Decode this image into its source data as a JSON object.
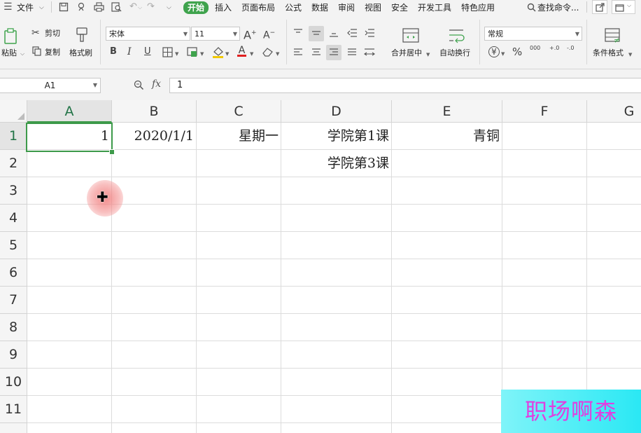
{
  "menubar": {
    "file_label": "文件",
    "tabs": [
      "开始",
      "插入",
      "页面布局",
      "公式",
      "数据",
      "审阅",
      "视图",
      "安全",
      "开发工具",
      "特色应用"
    ],
    "active_tab": "开始",
    "search_label": "查找命令...",
    "accent_color": "#3fa34d"
  },
  "ribbon": {
    "paste_label": "粘贴",
    "cut_label": "剪切",
    "copy_label": "复制",
    "format_painter_label": "格式刷",
    "font_name": "宋体",
    "font_size": "11",
    "grow_font_label": "A",
    "shrink_font_label": "A",
    "bold_label": "B",
    "italic_label": "I",
    "underline_label": "U",
    "font_color_label": "A",
    "merge_center_label": "合并居中",
    "wrap_text_label": "自动换行",
    "number_format": "常规",
    "currency_label": "¥",
    "percent_label": "%",
    "thousands_label": "000",
    "inc_decimal_label": "+.0",
    "dec_decimal_label": "-.0",
    "conditional_format_label": "条件格式"
  },
  "formula_bar": {
    "name_box": "A1",
    "fx_label": "fx",
    "content": "1"
  },
  "sheet": {
    "columns": [
      "A",
      "B",
      "C",
      "D",
      "E",
      "F",
      "G"
    ],
    "rows": [
      "1",
      "2",
      "3",
      "4",
      "5",
      "6",
      "7",
      "8",
      "9",
      "10",
      "11"
    ],
    "selected_cell": "A1",
    "cells": {
      "A1": "1",
      "B1": "2020/1/1",
      "C1": "星期一",
      "D1": "学院第1课",
      "E1": "青铜",
      "D2": "学院第3课"
    }
  },
  "watermark": {
    "text": "职场啊森"
  }
}
